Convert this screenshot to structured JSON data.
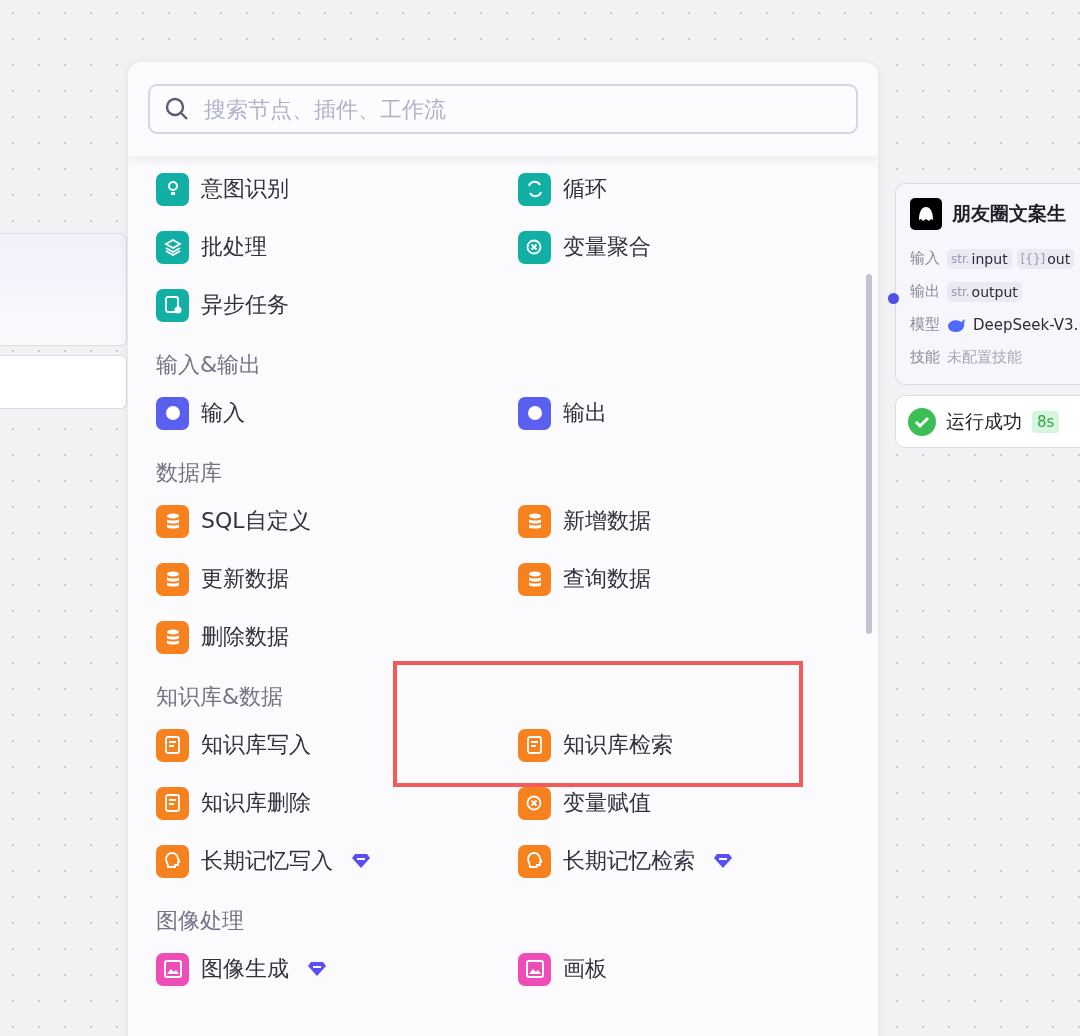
{
  "search": {
    "placeholder": "搜索节点、插件、工作流"
  },
  "sections": [
    {
      "items": [
        {
          "label": "意图识别",
          "color": "#12b0a4",
          "premium": false
        },
        {
          "label": "循环",
          "color": "#12b0a4",
          "premium": false
        },
        {
          "label": "批处理",
          "color": "#12b0a4",
          "premium": false
        },
        {
          "label": "变量聚合",
          "color": "#12b0a4",
          "premium": false
        },
        {
          "label": "异步任务",
          "color": "#12b0a4",
          "premium": false
        }
      ]
    },
    {
      "title": "输入&输出",
      "items": [
        {
          "label": "输入",
          "color": "#5a5ff0",
          "premium": false
        },
        {
          "label": "输出",
          "color": "#5a5ff0",
          "premium": false
        }
      ]
    },
    {
      "title": "数据库",
      "items": [
        {
          "label": "SQL自定义",
          "color": "#f5821f",
          "premium": false
        },
        {
          "label": "新增数据",
          "color": "#f5821f",
          "premium": false
        },
        {
          "label": "更新数据",
          "color": "#f5821f",
          "premium": false
        },
        {
          "label": "查询数据",
          "color": "#f5821f",
          "premium": false
        },
        {
          "label": "删除数据",
          "color": "#f5821f",
          "premium": false
        }
      ]
    },
    {
      "title": "知识库&数据",
      "items": [
        {
          "label": "知识库写入",
          "color": "#f5821f",
          "premium": false
        },
        {
          "label": "知识库检索",
          "color": "#f5821f",
          "premium": false
        },
        {
          "label": "知识库删除",
          "color": "#f5821f",
          "premium": false
        },
        {
          "label": "变量赋值",
          "color": "#f5821f",
          "premium": false
        },
        {
          "label": "长期记忆写入",
          "color": "#f5821f",
          "premium": true
        },
        {
          "label": "长期记忆检索",
          "color": "#f5821f",
          "premium": true
        }
      ]
    },
    {
      "title": "图像处理",
      "items": [
        {
          "label": "图像生成",
          "color": "#ee4db8",
          "premium": true
        },
        {
          "label": "画板",
          "color": "#ee4db8",
          "premium": false
        }
      ]
    }
  ],
  "node": {
    "title": "朋友圈文案生",
    "rows": [
      {
        "label": "输入",
        "kind": "tags",
        "tags": [
          {
            "type": "str.",
            "name": "input"
          },
          {
            "type": "[{}]",
            "name": "out"
          }
        ]
      },
      {
        "label": "输出",
        "kind": "tags",
        "tags": [
          {
            "type": "str.",
            "name": "output"
          }
        ]
      },
      {
        "label": "模型",
        "kind": "model",
        "value": "DeepSeek-V3."
      },
      {
        "label": "技能",
        "kind": "muted",
        "value": "未配置技能"
      }
    ]
  },
  "status": {
    "label": "运行成功",
    "duration": "8s"
  }
}
